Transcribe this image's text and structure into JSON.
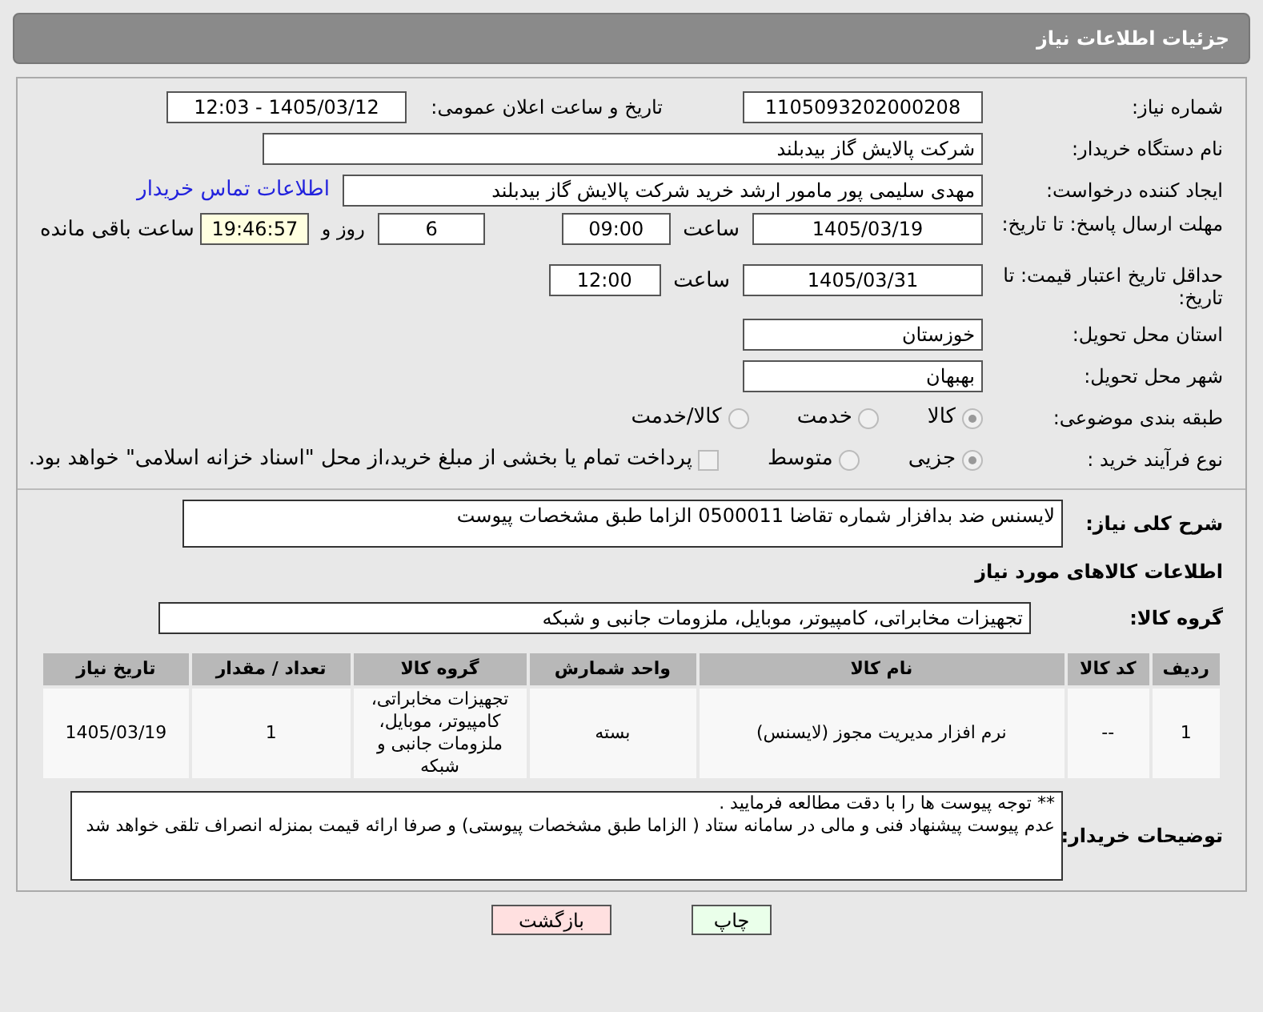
{
  "header": {
    "title": "جزئیات اطلاعات نیاز"
  },
  "need_number": {
    "label": "شماره نیاز:",
    "value": "1105093202000208"
  },
  "announce": {
    "label": "تاریخ و ساعت اعلان عمومی:",
    "value": "1405/03/12 - 12:03"
  },
  "buyer": {
    "label": "نام دستگاه خریدار:",
    "value": "شرکت پالایش گاز بیدبلند"
  },
  "creator": {
    "label": "ایجاد کننده درخواست:",
    "value": "مهدی سلیمی پور مامور ارشد خرید شرکت پالایش گاز بیدبلند",
    "link": "اطلاعات تماس خریدار"
  },
  "deadline": {
    "label": "مهلت ارسال پاسخ: تا تاریخ:",
    "date": "1405/03/19",
    "time_label": "ساعت",
    "time": "09:00",
    "days": "6",
    "days_label": "روز و",
    "remaining": "19:46:57",
    "remaining_label": "ساعت باقی مانده"
  },
  "validity": {
    "label": "حداقل تاریخ اعتبار قیمت: تا تاریخ:",
    "date": "1405/03/31",
    "time_label": "ساعت",
    "time": "12:00"
  },
  "province": {
    "label": "استان محل تحویل:",
    "value": "خوزستان"
  },
  "city": {
    "label": "شهر محل تحویل:",
    "value": "بهبهان"
  },
  "category": {
    "label": "طبقه بندی موضوعی:",
    "options": [
      {
        "label": "کالا",
        "selected": true
      },
      {
        "label": "خدمت",
        "selected": false
      },
      {
        "label": "کالا/خدمت",
        "selected": false
      }
    ]
  },
  "process": {
    "label": "نوع فرآیند خرید :",
    "options": [
      {
        "label": "جزیی",
        "selected": true
      },
      {
        "label": "متوسط",
        "selected": false
      }
    ],
    "treasury": {
      "label": "پرداخت تمام یا بخشی از مبلغ خرید،از محل \"اسناد خزانه اسلامی\" خواهد بود.",
      "checked": false
    }
  },
  "description": {
    "label": "شرح کلی نیاز:",
    "value": "لایسنس ضد بدافزار شماره تقاضا   0500011 الزاما طبق مشخصات پیوست"
  },
  "goods_heading": "اطلاعات کالاهای مورد نیاز",
  "goods_group": {
    "label": "گروه کالا:",
    "value": "تجهیزات مخابراتی، کامپیوتر، موبایل، ملزومات جانبی و شبکه"
  },
  "table": {
    "columns": [
      "ردیف",
      "کد کالا",
      "نام کالا",
      "واحد شمارش",
      "گروه کالا",
      "تعداد / مقدار",
      "تاریخ نیاز"
    ],
    "rows": [
      [
        "1",
        "--",
        "نرم افزار مدیریت مجوز (لایسنس)",
        "بسته",
        "تجهیزات مخابراتی، کامپیوتر، موبایل، ملزومات جانبی و شبکه",
        "1",
        "1405/03/19"
      ]
    ]
  },
  "notes": {
    "label": "توضیحات خریدار:",
    "lines": [
      "** توجه پیوست ها  را با دقت مطالعه فرمایید .",
      "عدم پیوست پیشنهاد فنی و مالی در سامانه ستاد ( الزاما طبق مشخصات پیوستی)  و صرفا ارائه قیمت بمنزله انصراف تلقی خواهد شد"
    ]
  },
  "buttons": [
    {
      "label": "چاپ",
      "kind": "print"
    },
    {
      "label": "بازگشت",
      "kind": "back"
    }
  ]
}
